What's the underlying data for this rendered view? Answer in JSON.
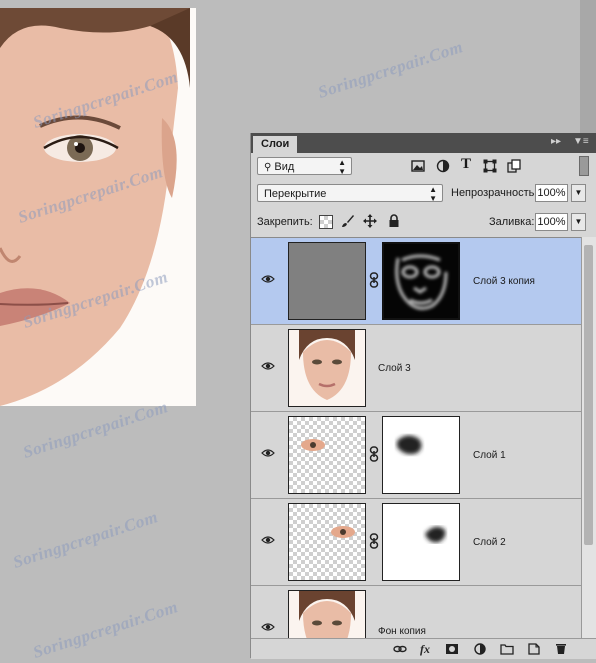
{
  "watermark": "Soringpcrepair.Com",
  "panel": {
    "tab_label": "Слои",
    "collapse_icon": "double-chevron-right",
    "menu_icon": "panel-menu"
  },
  "filter": {
    "kind_label": "Вид",
    "icons": [
      "image-filter-icon",
      "adjustment-filter-icon",
      "type-filter-icon",
      "shape-filter-icon",
      "smart-object-filter-icon"
    ]
  },
  "blend": {
    "mode": "Перекрытие",
    "opacity_label": "Непрозрачность:",
    "opacity_value": "100%"
  },
  "lock": {
    "label": "Закрепить:",
    "fill_label": "Заливка:",
    "fill_value": "100%"
  },
  "layers": [
    {
      "name": "Слой 3 копия",
      "selected": true,
      "visible": true
    },
    {
      "name": "Слой 3",
      "selected": false,
      "visible": true
    },
    {
      "name": "Слой 1",
      "selected": false,
      "visible": true
    },
    {
      "name": "Слой 2",
      "selected": false,
      "visible": true
    },
    {
      "name": "Фон копия",
      "selected": false,
      "visible": true
    }
  ],
  "footer": {
    "icons": [
      "link-layers-icon",
      "fx-icon",
      "add-mask-icon",
      "adjustment-layer-icon",
      "new-group-icon",
      "new-layer-icon",
      "delete-layer-icon"
    ],
    "fx_label": "fx"
  },
  "colors": {
    "panel_bg": "#d6d6d6",
    "selected_row": "#b4c9ef",
    "workspace": "#bcbcbc"
  }
}
